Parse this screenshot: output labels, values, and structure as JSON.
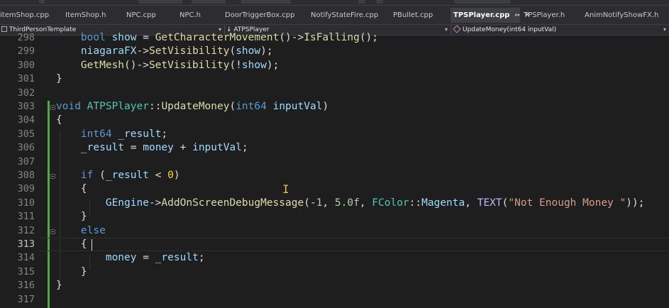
{
  "tabs": [
    {
      "label": "itemShop.cpp"
    },
    {
      "label": "ItemShop.h"
    },
    {
      "label": "NPC.cpp"
    },
    {
      "label": "NPC.h"
    },
    {
      "label": "DoorTriggerBox.cpp"
    },
    {
      "label": "NotifyStateFire.cpp"
    },
    {
      "label": "PBullet.cpp"
    },
    {
      "label": "TPSPlayer.cpp",
      "active": true,
      "pin_icon": "pin-icon",
      "close_icon": "close-icon"
    },
    {
      "label": "TPSPlayer.h"
    },
    {
      "label": "AnimNotifyShowFX.h"
    }
  ],
  "navigation": {
    "project": "ThirdPersonTemplate",
    "scope": "↓ ATPSPlayer",
    "member": "UpdateMoney(int64 inputVal)"
  },
  "editor": {
    "current_line": "313",
    "lines": [
      {
        "number": "298",
        "text": "    bool show = GetCharacterMovement()->IsFalling();"
      },
      {
        "number": "299",
        "text": "    niagaraFX->SetVisibility(show);"
      },
      {
        "number": "300",
        "text": "    GetMesh()->SetVisibility(!show);"
      },
      {
        "number": "301",
        "text": "}"
      },
      {
        "number": "302",
        "text": ""
      },
      {
        "number": "303",
        "text": "void ATPSPlayer::UpdateMoney(int64 inputVal)"
      },
      {
        "number": "304",
        "text": "{"
      },
      {
        "number": "305",
        "text": "    int64 _result;"
      },
      {
        "number": "306",
        "text": "    _result = money + inputVal;"
      },
      {
        "number": "307",
        "text": ""
      },
      {
        "number": "308",
        "text": "    if (_result < 0)"
      },
      {
        "number": "309",
        "text": "    {"
      },
      {
        "number": "310",
        "text": "        GEngine->AddOnScreenDebugMessage(-1, 5.0f, FColor::Magenta, TEXT(\"Not Enough Money \"));"
      },
      {
        "number": "311",
        "text": "    }"
      },
      {
        "number": "312",
        "text": "    else"
      },
      {
        "number": "313",
        "text": "    {"
      },
      {
        "number": "314",
        "text": "        money = _result;"
      },
      {
        "number": "315",
        "text": "    }"
      },
      {
        "number": "316",
        "text": "}"
      },
      {
        "number": "317",
        "text": ""
      }
    ]
  },
  "colors": {
    "background": "#1e1e1e",
    "keyword": "#569cd6",
    "type": "#4ec9b0",
    "function": "#dcdcaa",
    "variable": "#9cdcfe",
    "number": "#b5cea8",
    "string": "#d69d85",
    "macro": "#beb7ff",
    "change_bar": "#57a64a"
  }
}
